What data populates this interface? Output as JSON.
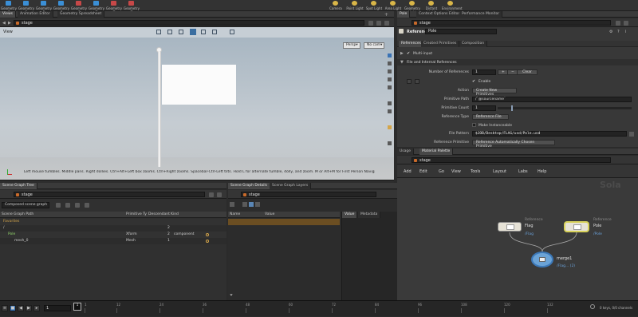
{
  "shelf": {
    "left_tools": [
      {
        "label": "Geometry C",
        "icon": "geometry-icon",
        "color": "#3b8fd6"
      },
      {
        "label": "Geometry P",
        "icon": "geometry-icon",
        "color": "#3b8fd6"
      },
      {
        "label": "Geometry B",
        "icon": "geometry-icon",
        "color": "#3b8fd6"
      },
      {
        "label": "Geometry S",
        "icon": "geometry-icon",
        "color": "#3b8fd6"
      },
      {
        "label": "Geometry C",
        "icon": "geometry-icon",
        "color": "#c74848"
      },
      {
        "label": "Geometry T",
        "icon": "geometry-icon",
        "color": "#3b8fd6"
      },
      {
        "label": "Geometry T",
        "icon": "geometry-icon",
        "color": "#c74848"
      },
      {
        "label": "Geometry T",
        "icon": "geometry-icon",
        "color": "#c74848"
      }
    ],
    "right_tools": [
      {
        "label": "Camera",
        "icon": "camera-icon"
      },
      {
        "label": "Point Light",
        "icon": "point-light-icon"
      },
      {
        "label": "Spot Light",
        "icon": "spot-light-icon"
      },
      {
        "label": "Area Light",
        "icon": "area-light-icon"
      },
      {
        "label": "Geometry Light",
        "icon": "geometry-light-icon"
      },
      {
        "label": "Distant Light",
        "icon": "distant-light-icon"
      },
      {
        "label": "Environment Light",
        "icon": "environment-light-icon"
      }
    ]
  },
  "viewer": {
    "tabs": [
      "Views",
      "Animation Editor",
      "Geometry Spreadsheet"
    ],
    "path": "stage",
    "pane_label": "View",
    "camera_menu": "Persp",
    "nocam_menu": "No cam",
    "status_text": "Left mouse tumbles. Middle pans. Right dollies. Ctrl+Alt+Left box zooms. Ctrl+Right zooms. Spacebar-Ctrl-Left tilts. Hold L for alternate tumble, dolly, and zoom.    M or Alt+M for First Person Navigation."
  },
  "params": {
    "tabs": [
      "Pole",
      "Context Options Editor",
      "Performance Monitor"
    ],
    "path": "stage",
    "node_type": "Reference",
    "node_name": "Pole",
    "sub_tabs": [
      "References",
      "Created Primitives",
      "Composition"
    ],
    "multi_input_label": "Multi-input",
    "section_label": "File and Internal References",
    "num_refs_label": "Number of References",
    "num_refs_value": "1",
    "clear_label": "Clear",
    "enable_label": "Enable",
    "action_label": "Action",
    "action_value": "Create New Primitives",
    "prim_path_label": "Primitive Path",
    "prim_path_value": "/`@sourcename`",
    "prim_count_label": "Primitive Count",
    "prim_count_value": "1",
    "ref_type_label": "Reference Type",
    "ref_type_value": "Reference File",
    "instanceable_label": "Make Instanceable",
    "file_pattern_label": "File Pattern",
    "file_pattern_value": "$JOB/Desktop/FLAG/usd/Pole.usd",
    "ref_prim_label": "Reference Primitive",
    "ref_prim_value": "Reference Automatically Chosen Primitive"
  },
  "scene_tree": {
    "tabs": [
      "Scene Graph Tree"
    ],
    "path": "stage",
    "filter": "Composed scene graph",
    "columns": [
      "Scene Graph Path",
      "Primitive Ty",
      "Descendant",
      "Kind"
    ],
    "rows": [
      {
        "name": "Favorites",
        "type": "",
        "desc": "",
        "kind": "",
        "color": "#d4a54a"
      },
      {
        "name": "/",
        "type": "",
        "desc": "2",
        "kind": "",
        "color": "#cfcfcf"
      },
      {
        "name": "Pole",
        "type": "Xform",
        "desc": "2",
        "kind": "component",
        "color": "#8fd06a"
      },
      {
        "name": "mesh_0",
        "type": "Mesh",
        "desc": "1",
        "kind": "",
        "color": "#cfcfcf"
      }
    ]
  },
  "details": {
    "tabs": [
      "Scene Graph Details",
      "Scene Graph Layers"
    ],
    "path": "stage",
    "columns": [
      "Name",
      "Value"
    ],
    "value_tabs": [
      "Value",
      "Metadata"
    ]
  },
  "network": {
    "tabs": [
      "Usage",
      "Material Palette"
    ],
    "path": "stage",
    "menu": [
      "Add",
      "Edit",
      "Go",
      "View",
      "Tools",
      "Layout",
      "Labs",
      "Help"
    ],
    "watermark": "Sola",
    "nodes": [
      {
        "type": "Reference",
        "name": "Flag",
        "path": "/Flag"
      },
      {
        "type": "Reference",
        "name": "Pole",
        "path": "/Pole"
      },
      {
        "type": "",
        "name": "merge1",
        "path": "/Flag... (2)"
      }
    ]
  },
  "timeline": {
    "frame": "1",
    "ticks": [
      "1",
      "12",
      "24",
      "36",
      "48",
      "60",
      "72",
      "84",
      "96",
      "108",
      "120",
      "132"
    ],
    "keys_text": "0 keys, 0/0 channels",
    "end_frame": "1"
  }
}
